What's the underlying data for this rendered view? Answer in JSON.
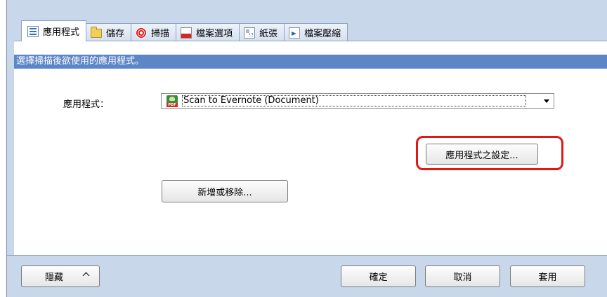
{
  "tabs": [
    {
      "label": "應用程式",
      "icon": "application-list-icon",
      "active": true
    },
    {
      "label": "儲存",
      "icon": "folder-icon",
      "active": false
    },
    {
      "label": "掃描",
      "icon": "scan-icon",
      "active": false
    },
    {
      "label": "檔案選項",
      "icon": "file-option-icon",
      "active": false
    },
    {
      "label": "紙張",
      "icon": "paper-icon",
      "active": false
    },
    {
      "label": "檔案壓縮",
      "icon": "compression-icon",
      "active": false
    }
  ],
  "panel": {
    "instruction": "選擇掃描後欲使用的應用程式。",
    "application_label": "應用程式：",
    "application_select": {
      "selected": "Scan to Evernote (Document)",
      "icon": "evernote-pdf-icon"
    },
    "app_settings_button": "應用程式之設定...",
    "add_remove_button": "新增或移除..."
  },
  "bottom": {
    "hide_button": "隱藏",
    "ok_button": "確定",
    "cancel_button": "取消",
    "apply_button": "套用"
  },
  "colors": {
    "instruction_bar": "#5d86c7",
    "window_background": "#c9d7ea",
    "highlight": "#e01818"
  }
}
